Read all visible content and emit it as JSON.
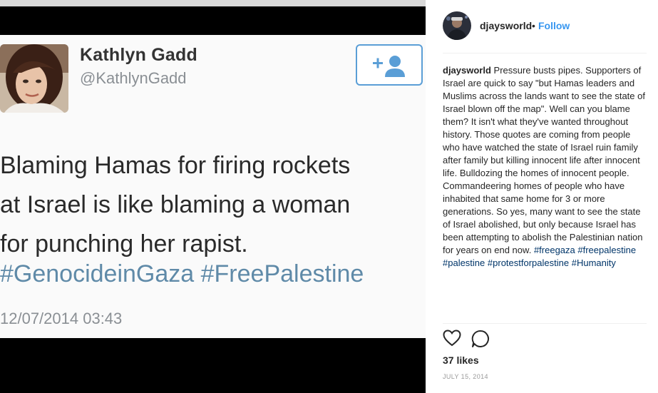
{
  "tweet": {
    "author_name": "Kathlyn Gadd",
    "author_handle": "@KathlynGadd",
    "text": "Blaming Hamas for firing rockets\nat Israel is like blaming a woman\nfor punching her rapist.",
    "hashtags": "#GenocideinGaza #FreePalestine",
    "timestamp": "12/07/2014 03:43",
    "follow_icon": "add-user-icon"
  },
  "post": {
    "username": "djaysworld",
    "separator": "•",
    "follow_label": "Follow",
    "caption_user": "djaysworld",
    "caption_text": "Pressure busts pipes. Supporters of Israel are quick to say \"but Hamas leaders and Muslims across the lands want to see the state of Israel blown off the map\". Well can you blame them? It isn't what they've wanted throughout history. Those quotes are coming from people who have watched the state of Israel ruin family after family but killing innocent life after innocent life. Bulldozing the homes of innocent people. Commandeering homes of people who have inhabited that same home for 3 or more generations. So yes, many want to see the state of Israel abolished, but only because Israel has been attempting to abolish the Palestinian nation for years on end now.",
    "caption_tags": [
      "#freegaza",
      "#freepalestine",
      "#palestine",
      "#protestforpalestine",
      "#Humanity"
    ],
    "likes": "37 likes",
    "date": "JULY 15, 2014",
    "link_color": "#3897f0",
    "tag_color": "#003569"
  }
}
